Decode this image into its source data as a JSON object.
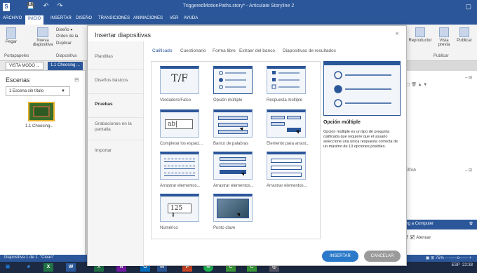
{
  "window": {
    "title": "TriggeredMotionPaths.story* - Articulate Storyline 2",
    "logo": "S"
  },
  "ribbon": {
    "tabs": [
      "ARCHIVO",
      "INICIO",
      "INSERTAR",
      "DISEÑO",
      "TRANSICIONES",
      "ANIMACIONES",
      "VER",
      "AYUDA"
    ],
    "active_tab": "INICIO",
    "pegar": "Pegar",
    "portapapeles": "Portapapeles",
    "nueva_diapositiva": "Nueva diapositiva",
    "diseno": "Diseño",
    "orden": "Orden de la",
    "duplicar": "Duplicar",
    "group_diapositiva": "Diapositiva",
    "reproductor": "Reproductor",
    "vista_previa": "Vista previa",
    "publicar": "Publicar",
    "group_publicar": "Publicar"
  },
  "left_panel": {
    "view_mode": "VISTA MODO ...",
    "scene_tab": "1.1 Choosing ...",
    "scenes_title": "Escenas",
    "scene_select": "1 Escena sin título",
    "slide_label": "1.1 Choosing..."
  },
  "dialog": {
    "title": "Insertar diapositivas",
    "side_items": [
      "Plantillas",
      "Diseños básicos",
      "Pruebas",
      "Grabaciones en la pantalla",
      "Importar"
    ],
    "active_side": "Pruebas",
    "category_tabs": [
      "Calificado",
      "Cuestionario",
      "Forma libre",
      "Extraer del banco",
      "Diapositivas de resultados"
    ],
    "active_category": "Calificado",
    "tiles": [
      {
        "label": "Verdadero/Falso",
        "icon": "true-false-icon",
        "glyph": "T/F"
      },
      {
        "label": "Opción múltiple",
        "icon": "multiple-choice-icon",
        "glyph": ""
      },
      {
        "label": "Respuesta múltiple",
        "icon": "multiple-response-icon",
        "glyph": ""
      },
      {
        "label": "Completar los espaci...",
        "icon": "fill-in-blank-icon",
        "glyph": "ab|"
      },
      {
        "label": "Banco de palabras",
        "icon": "word-bank-icon",
        "glyph": ""
      },
      {
        "label": "Elemento para arrast...",
        "icon": "drag-item-icon",
        "glyph": ""
      },
      {
        "label": "Arrastrar elementos...",
        "icon": "matching-drag-icon",
        "glyph": ""
      },
      {
        "label": "Arrastrar elementos...",
        "icon": "sequence-drag-icon",
        "glyph": ""
      },
      {
        "label": "Arrastrar elementos...",
        "icon": "matching-dropdown-icon",
        "glyph": ""
      },
      {
        "label": "Numérico",
        "icon": "numeric-icon",
        "glyph": "125"
      },
      {
        "label": "Punto clave",
        "icon": "hotspot-icon",
        "glyph": ""
      }
    ],
    "selected_tile": "Opción múltiple",
    "preview_title": "Opción múltiple",
    "preview_description": "Opción múltiple es un tipo de pregunta calificada que requiere que el usuario seleccione una única respuesta correcta de un máximo de 10 opciones posibles.",
    "insert_label": "INSERTAR",
    "cancel_label": "CANCELAR"
  },
  "right_panel": {
    "panel_label": "sitiva",
    "computer_label": "sing a Computer",
    "attenuate": "Atenuar"
  },
  "status": {
    "slide": "Diapositiva 1 de 1",
    "theme": "\"Clean\"",
    "zoom": "75%"
  },
  "taskbar": {
    "lang": "ESP",
    "time": "22:38"
  },
  "colors": {
    "brand": "#2b579a",
    "insert_button": "#2b79c9",
    "cancel_button": "#9a9a9a"
  }
}
